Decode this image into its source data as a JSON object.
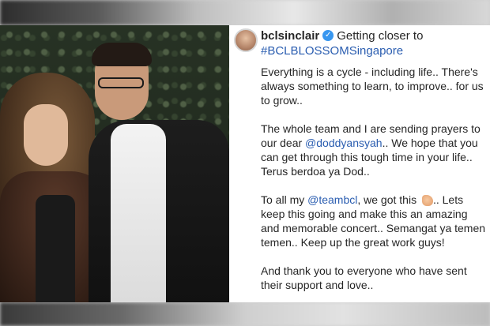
{
  "post": {
    "username": "bclsinclair",
    "header_text": "Getting closer to",
    "hashtag": "#BCLBLOSSOMSingapore"
  },
  "caption": {
    "p1": "Everything is a cycle - including life.. There's always something to learn, to improve.. for us to grow..",
    "p2_before": "The whole team and I are sending prayers to our dear ",
    "p2_mention": "@doddyansyah",
    "p2_after": ".. We hope that you can get through this tough time in your life.. Terus berdoa ya Dod..",
    "p3_before": "To all my ",
    "p3_mention": "@teambcl",
    "p3_mid": ", we got this ",
    "p3_after": ".. Lets keep this going and make this an amazing and memorable concert.. Semangat ya temen temen.. Keep up the great work guys!",
    "p4": "And thank you to everyone who have sent their support and love.."
  },
  "icons": {
    "verified": "verified-badge-icon",
    "emoji": "flexed-biceps-emoji"
  },
  "colors": {
    "link": "#2a5db0",
    "verified": "#3897f0",
    "text": "#262626"
  }
}
